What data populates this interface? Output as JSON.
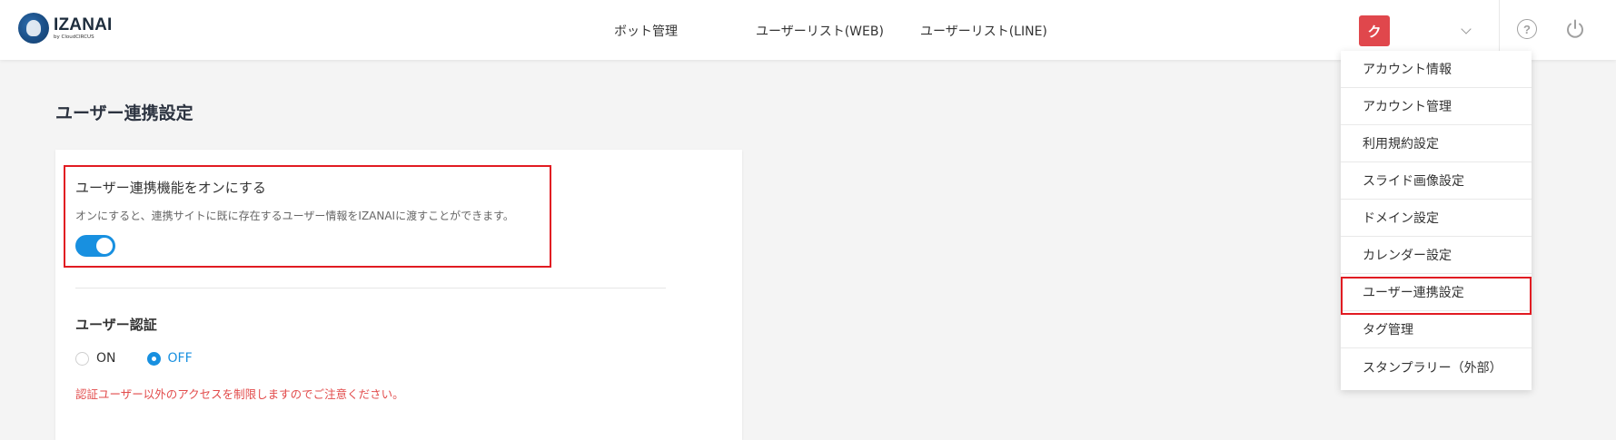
{
  "header": {
    "logo_name": "IZANAI",
    "logo_sub": "by CloudCIRCUS",
    "nav": [
      "ボット管理",
      "ユーザーリスト(WEB)",
      "ユーザーリスト(LINE)"
    ],
    "avatar_initial": "ク",
    "help_glyph": "?"
  },
  "main": {
    "page_title": "ユーザー連携設定",
    "feature_title": "ユーザー連携機能をオンにする",
    "feature_desc": "オンにすると、連携サイトに既に存在するユーザー情報をIZANAIに渡すことができます。",
    "feature_enabled": true,
    "auth_title": "ユーザー認証",
    "auth_options": [
      "ON",
      "OFF"
    ],
    "auth_selected": "OFF",
    "warning": "認証ユーザー以外のアクセスを制限しますのでご注意ください。"
  },
  "dropdown": {
    "items": [
      "アカウント情報",
      "アカウント管理",
      "利用規約設定",
      "スライド画像設定",
      "ドメイン設定",
      "カレンダー設定",
      "ユーザー連携設定",
      "タグ管理",
      "スタンプラリー（外部）"
    ],
    "highlighted": "ユーザー連携設定"
  },
  "colors": {
    "accent": "#1890e0",
    "highlight": "#e11b22",
    "warning": "#e24b4b",
    "avatar": "#e0474c"
  },
  "icons": {
    "chevron": "chevron-down-icon",
    "help": "help-circle-icon",
    "power": "power-icon"
  }
}
